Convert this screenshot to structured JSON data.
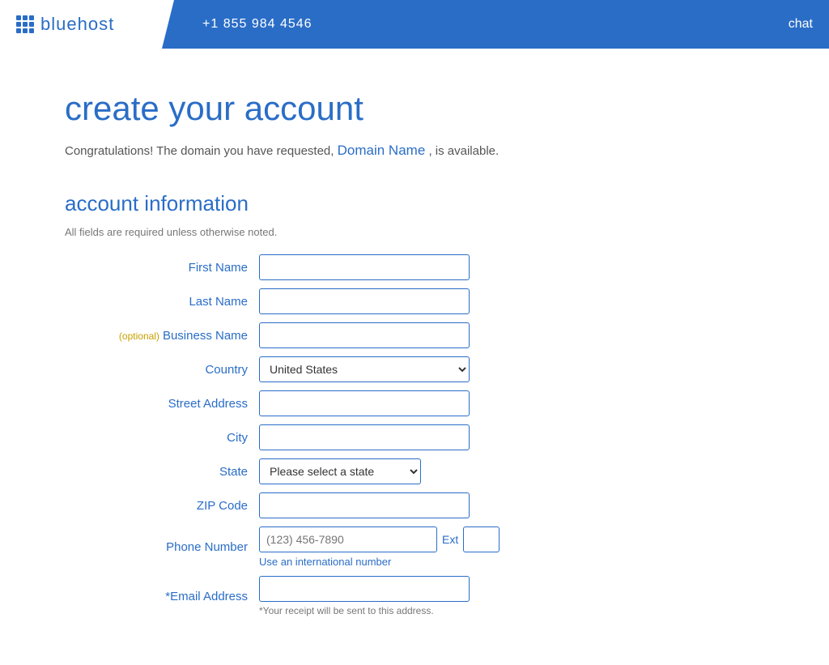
{
  "header": {
    "logo_text": "bluehost",
    "phone": "+1 855 984 4546",
    "chat_label": "chat"
  },
  "page": {
    "title": "create your account",
    "domain_message_pre": "Congratulations! The domain you have requested,",
    "domain_name": "Domain Name",
    "domain_message_post": ", is available."
  },
  "account_section": {
    "title": "account information",
    "fields_note": "All fields are required unless otherwise noted.",
    "labels": {
      "first_name": "First Name",
      "last_name": "Last Name",
      "business_name": "Business Name",
      "country": "Country",
      "street_address": "Street Address",
      "city": "City",
      "state": "State",
      "zip_code": "ZIP Code",
      "phone_number": "Phone Number",
      "email_address": "*Email Address"
    },
    "optional_text": "(optional)",
    "country_value": "United States",
    "state_placeholder": "Please select a state",
    "phone_placeholder": "(123) 456-7890",
    "ext_label": "Ext",
    "intl_link": "Use an international number",
    "email_note": "*Your receipt will be sent to this address."
  }
}
